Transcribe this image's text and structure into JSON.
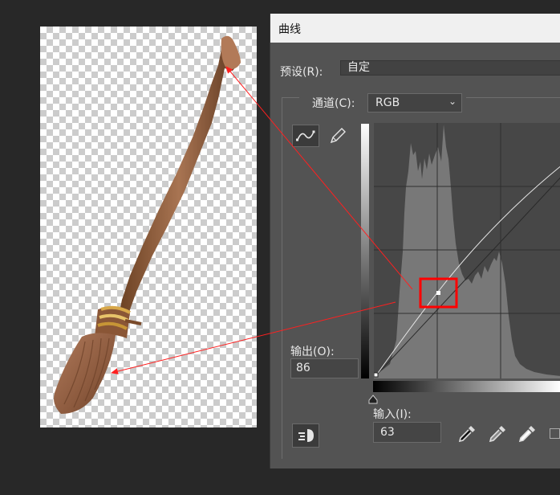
{
  "dialog": {
    "title": "曲线",
    "preset_label": "预设(R):",
    "preset_value": "自定",
    "channel_label": "通道(C):",
    "channel_value": "RGB",
    "output_label": "输出(O):",
    "output_value": "86",
    "input_label": "输入(I):",
    "input_value": "63"
  },
  "colors": {
    "app_background": "#282828",
    "dialog_background": "#535353",
    "title_bar": "#f0f0f0",
    "annotation_red": "#ff0000",
    "histogram_fill": "#787878"
  },
  "icons": {
    "curve_tool": "curve-icon",
    "pencil_tool": "pencil-icon",
    "histogram_options": "auto-tone-icon",
    "eyedroppers": [
      "black-point-eyedropper-icon",
      "gray-point-eyedropper-icon",
      "white-point-eyedropper-icon"
    ]
  },
  "curve": {
    "selected_point": {
      "input": 63,
      "output": 86
    }
  }
}
